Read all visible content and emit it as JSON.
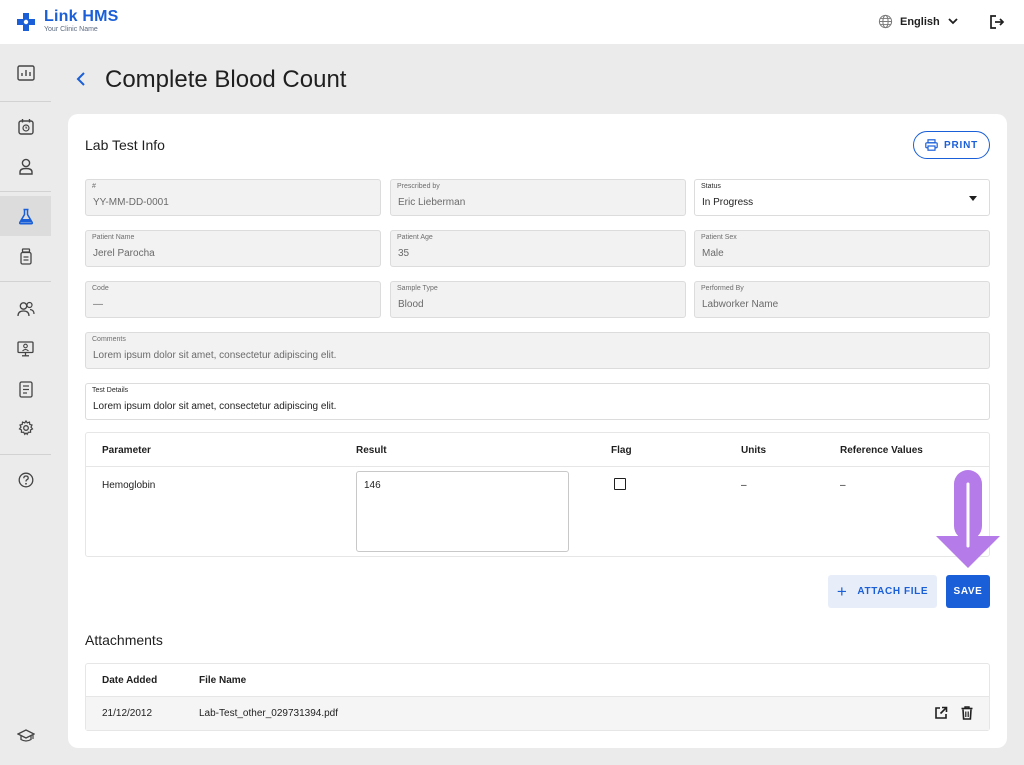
{
  "app": {
    "name": "Link HMS",
    "subtitle": "Your Clinic Name",
    "brand_color": "#1a5fd8"
  },
  "header": {
    "language": "English",
    "icons": [
      "globe-icon",
      "chevron-down-icon",
      "logout-icon"
    ]
  },
  "sidebar": {
    "items": [
      {
        "icon": "dashboard-icon"
      },
      {
        "icon": "appointment-icon"
      },
      {
        "icon": "patient-icon"
      },
      {
        "icon": "lab-icon",
        "active": true
      },
      {
        "icon": "medication-icon"
      },
      {
        "icon": "users-icon"
      },
      {
        "icon": "monitor-icon"
      },
      {
        "icon": "reports-icon"
      },
      {
        "icon": "settings-icon"
      },
      {
        "icon": "help-icon"
      },
      {
        "icon": "education-icon"
      }
    ]
  },
  "page": {
    "title": "Complete Blood Count"
  },
  "labinfo": {
    "title": "Lab Test Info",
    "print_label": "PRINT",
    "fields": {
      "id": {
        "label": "#",
        "value": "YY-MM-DD-0001"
      },
      "prescribed_by": {
        "label": "Prescribed by",
        "value": "Eric Lieberman"
      },
      "status": {
        "label": "Status",
        "value": "In Progress"
      },
      "patient_name": {
        "label": "Patient Name",
        "value": "Jerel Parocha"
      },
      "patient_age": {
        "label": "Patient Age",
        "value": "35"
      },
      "patient_sex": {
        "label": "Patient Sex",
        "value": "Male"
      },
      "code": {
        "label": "Code",
        "value": "—"
      },
      "sample_type": {
        "label": "Sample Type",
        "value": "Blood"
      },
      "performed_by": {
        "label": "Performed By",
        "value": "Labworker Name"
      },
      "comments": {
        "label": "Comments",
        "value": "Lorem ipsum dolor sit amet, consectetur adipiscing elit."
      },
      "test_details": {
        "label": "Test Details",
        "value": "Lorem ipsum dolor sit amet, consectetur adipiscing elit."
      }
    }
  },
  "params": {
    "headers": {
      "parameter": "Parameter",
      "result": "Result",
      "flag": "Flag",
      "units": "Units",
      "reference": "Reference Values"
    },
    "rows": [
      {
        "parameter": "Hemoglobin",
        "result": "146",
        "flag": false,
        "units": "–",
        "reference": "–"
      }
    ]
  },
  "actions": {
    "attach_label": "ATTACH FILE",
    "save_label": "SAVE",
    "arrow_color": "#b57be8"
  },
  "attachments": {
    "title": "Attachments",
    "headers": {
      "date": "Date Added",
      "file": "File Name"
    },
    "rows": [
      {
        "date": "21/12/2012",
        "file": "Lab-Test_other_029731394.pdf"
      }
    ]
  }
}
